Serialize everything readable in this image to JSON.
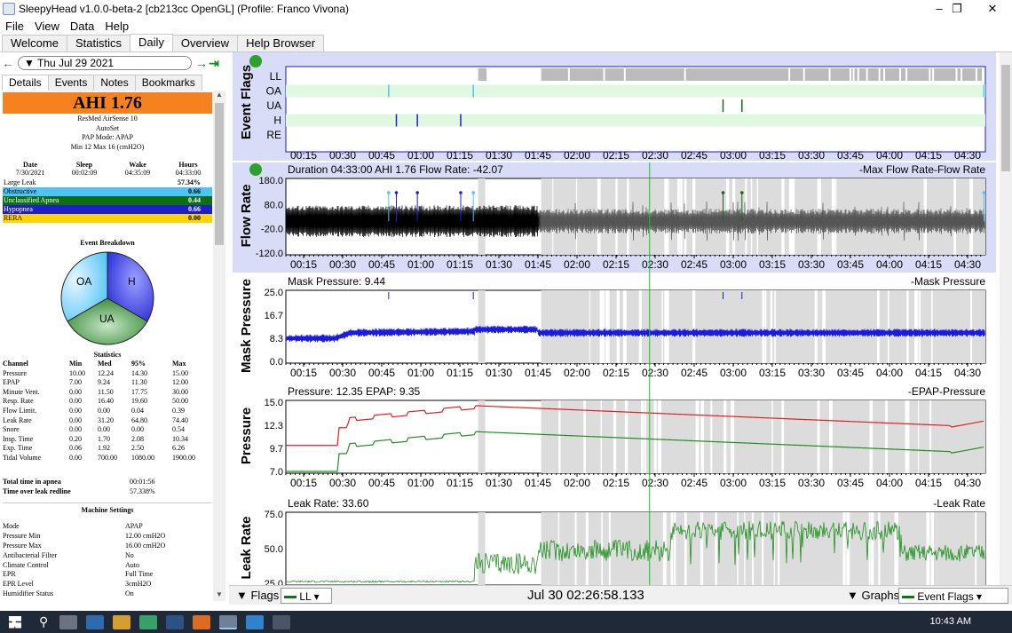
{
  "window": {
    "title": "SleepyHead v1.0.0-beta-2 [cb213cc OpenGL] (Profile: Franco Vivona)"
  },
  "menu": [
    "File",
    "View",
    "Data",
    "Help"
  ],
  "tabs": [
    "Welcome",
    "Statistics",
    "Daily",
    "Overview",
    "Help Browser"
  ],
  "date": "Thu Jul 29 2021",
  "subtabs": [
    "Details",
    "Events",
    "Notes",
    "Bookmarks"
  ],
  "ahi": "AHI 1.76",
  "device": [
    "ResMed AirSense 10",
    "AutoSet",
    "PAP Mode: APAP",
    "Min 12 Max 16 (cmH2O)"
  ],
  "session": {
    "headers": [
      "Date",
      "Sleep",
      "Wake",
      "Hours"
    ],
    "values": [
      "7/30/2021",
      "00:02:09",
      "04:35:09",
      "04:33:00"
    ]
  },
  "event_rows": [
    {
      "label": "Large Leak",
      "value": "57.34%",
      "color": "#ffffff"
    },
    {
      "label": "Obstructive",
      "value": "0.66",
      "color": "#4dc3f7"
    },
    {
      "label": "Unclassified Apnea",
      "value": "0.44",
      "color": "#0f6e0f",
      "text": "#ffffff"
    },
    {
      "label": "Hypopnea",
      "value": "0.66",
      "color": "#1e1ed0",
      "text": "#ffffff"
    },
    {
      "label": "RERA",
      "value": "0.00",
      "color": "#ffd400"
    }
  ],
  "pie": {
    "title": "Event Breakdown",
    "labels": [
      "OA",
      "H",
      "UA"
    ]
  },
  "stats": {
    "title": "Statistics",
    "headers": [
      "Channel",
      "Min",
      "Med",
      "95%",
      "Max"
    ],
    "rows": [
      [
        "Pressure",
        "10.00",
        "12.24",
        "14.30",
        "15.00"
      ],
      [
        "EPAP",
        "7.00",
        "9.24",
        "11.30",
        "12.00"
      ],
      [
        "Minute Vent.",
        "0.00",
        "11.50",
        "17.75",
        "30.00"
      ],
      [
        "Resp. Rate",
        "0.00",
        "16.40",
        "19.60",
        "50.00"
      ],
      [
        "Flow Limit.",
        "0.00",
        "0.00",
        "0.04",
        "0.39"
      ],
      [
        "Leak Rate",
        "0.00",
        "31.20",
        "64.80",
        "74.40"
      ],
      [
        "Snore",
        "0.00",
        "0.00",
        "0.00",
        "0.54"
      ],
      [
        "Insp. Time",
        "0.20",
        "1.70",
        "2.08",
        "10.34"
      ],
      [
        "Exp. Time",
        "0.06",
        "1.92",
        "2.50",
        "6.26"
      ],
      [
        "Tidal Volume",
        "0.00",
        "700.00",
        "1080.00",
        "1900.00"
      ]
    ]
  },
  "totals": [
    [
      "Total time in apnea",
      "00:01:56"
    ],
    [
      "Time over leak redline",
      "57.338%"
    ]
  ],
  "machine": {
    "title": "Machine Settings",
    "rows": [
      [
        "Mode",
        "APAP"
      ],
      [
        "Pressure Min",
        "12.00 cmH2O"
      ],
      [
        "Pressure Max",
        "16.00 cmH2O"
      ],
      [
        "Antibacterial Filter",
        "No"
      ],
      [
        "Climate Control",
        "Auto"
      ],
      [
        "EPR",
        "Full Time"
      ],
      [
        "EPR Level",
        "3cmH2O"
      ],
      [
        "Humidifier Status",
        "On"
      ]
    ]
  },
  "time_ticks": [
    "00:15",
    "00:30",
    "00:45",
    "01:00",
    "01:15",
    "01:30",
    "01:45",
    "02:00",
    "02:15",
    "02:30",
    "02:45",
    "03:00",
    "03:15",
    "03:30",
    "03:45",
    "04:00",
    "04:15",
    "04:30"
  ],
  "panels": {
    "event_flags": {
      "ylabel": "Event Flags",
      "rows": [
        "LL",
        "OA",
        "UA",
        "H",
        "RE"
      ]
    },
    "flow": {
      "ylabel": "Flow Rate",
      "info": "Duration 04:33:00 AHI 1.76 Flow Rate: -42.07",
      "legend": "-Max Flow Rate-Flow Rate",
      "yticks": [
        "180.0",
        "80.0",
        "-20.0",
        "-120.0"
      ]
    },
    "mask": {
      "ylabel": "Mask Pressure",
      "info": "Mask Pressure: 9.44",
      "legend": "-Mask Pressure",
      "yticks": [
        "25.0",
        "16.7",
        "8.3",
        "0.0"
      ]
    },
    "pressure": {
      "ylabel": "Pressure",
      "info": "Pressure: 12.35 EPAP: 9.35",
      "legend": "-EPAP-Pressure",
      "yticks": [
        "15.0",
        "12.3",
        "9.7",
        "7.0"
      ]
    },
    "leak": {
      "ylabel": "Leak Rate",
      "info": "Leak Rate: 33.60",
      "legend": "-Leak Rate",
      "yticks": [
        "75.0",
        "50.0",
        "25.0"
      ]
    }
  },
  "bottom": {
    "flags": "Flags",
    "ll": "LL",
    "time": "Jul 30 02:26:58.133",
    "graphs": "Graphs",
    "evflags": "Event Flags"
  },
  "clock": "10:43 AM"
}
